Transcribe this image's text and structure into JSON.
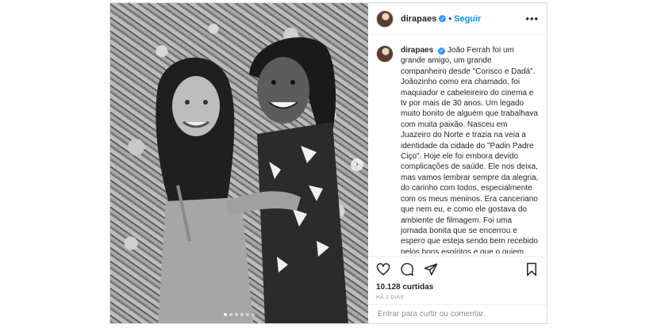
{
  "post": {
    "username": "dirapaes",
    "separator": "•",
    "follow_label": "Seguir",
    "more_icon": "more-icon",
    "verified_icon": "verified-badge-icon",
    "caption": "João Ferrah foi um grande amigo, um grande companheiro desde \"Corisco e Dadá\". Joãozinho como era chamado, foi maquiador e cabeleireiro do cinema e tv por mais de 30 anos. Um legado muito bonito de alguém que trabalhava com muita paixão. Nasceu em Juazeiro do Norte e trazia na veia a identidade da cidade do \"Padin Padre Ciço\". Hoje ele foi embora devido complicações de saúde. Ele nos deixa, mas vamos lembrar sempre da alegria, do carinho com todos, especialmente com os meus meninos. Era canceriano que nem eu, e como ele gostava do ambiente de filmagem. Foi uma jornada bonita que se encerrou e espero que esteja sendo bem recebido pelos bons espíritos e que o guiem. Descanse",
    "likes": "10.128 curtidas",
    "date": "HÁ 2 DIAS",
    "comment_placeholder": "Entrar para curtir ou comentar.",
    "carousel_next": "›",
    "carousel_count": 6,
    "carousel_active": 1
  },
  "icons": {
    "like": "heart-icon",
    "comment": "comment-icon",
    "share": "share-icon",
    "save": "bookmark-icon"
  },
  "colors": {
    "link": "#0095f6",
    "verified": "#3897f0",
    "text": "#262626",
    "muted": "#8e8e8e",
    "border": "#dbdbdb"
  }
}
